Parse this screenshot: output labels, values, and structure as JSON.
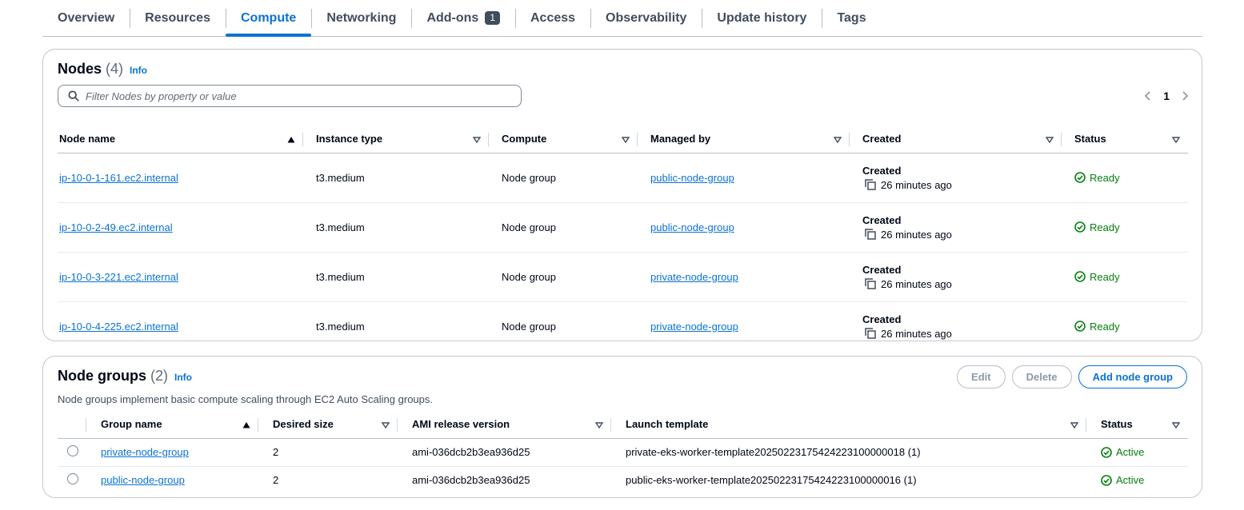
{
  "tabs": [
    {
      "label": "Overview"
    },
    {
      "label": "Resources"
    },
    {
      "label": "Compute",
      "active": true
    },
    {
      "label": "Networking"
    },
    {
      "label": "Add-ons",
      "badge": "1"
    },
    {
      "label": "Access"
    },
    {
      "label": "Observability"
    },
    {
      "label": "Update history"
    },
    {
      "label": "Tags"
    }
  ],
  "nodes": {
    "title": "Nodes",
    "count": "(4)",
    "info": "Info",
    "search_placeholder": "Filter Nodes by property or value",
    "page": "1",
    "columns": [
      "Node name",
      "Instance type",
      "Compute",
      "Managed by",
      "Created",
      "Status"
    ],
    "rows": [
      {
        "name": "ip-10-0-1-161.ec2.internal",
        "instance_type": "t3.medium",
        "compute": "Node group",
        "managed_by": "public-node-group",
        "created_label": "Created",
        "created": "26 minutes ago",
        "status": "Ready"
      },
      {
        "name": "ip-10-0-2-49.ec2.internal",
        "instance_type": "t3.medium",
        "compute": "Node group",
        "managed_by": "public-node-group",
        "created_label": "Created",
        "created": "26 minutes ago",
        "status": "Ready"
      },
      {
        "name": "ip-10-0-3-221.ec2.internal",
        "instance_type": "t3.medium",
        "compute": "Node group",
        "managed_by": "private-node-group",
        "created_label": "Created",
        "created": "26 minutes ago",
        "status": "Ready"
      },
      {
        "name": "ip-10-0-4-225.ec2.internal",
        "instance_type": "t3.medium",
        "compute": "Node group",
        "managed_by": "private-node-group",
        "created_label": "Created",
        "created": "26 minutes ago",
        "status": "Ready"
      }
    ]
  },
  "node_groups": {
    "title": "Node groups",
    "count": "(2)",
    "info": "Info",
    "description": "Node groups implement basic compute scaling through EC2 Auto Scaling groups.",
    "buttons": {
      "edit": "Edit",
      "delete": "Delete",
      "add": "Add node group"
    },
    "columns": [
      "Group name",
      "Desired size",
      "AMI release version",
      "Launch template",
      "Status"
    ],
    "rows": [
      {
        "name": "private-node-group",
        "desired_size": "2",
        "ami": "ami-036dcb2b3ea936d25",
        "launch_template": "private-eks-worker-template20250223175424223100000018 (1)",
        "status": "Active"
      },
      {
        "name": "public-node-group",
        "desired_size": "2",
        "ami": "ami-036dcb2b3ea936d25",
        "launch_template": "public-eks-worker-template20250223175424223100000016 (1)",
        "status": "Active"
      }
    ]
  },
  "colors": {
    "link": "#0972d3",
    "success": "#037f0c",
    "text": "#000716"
  }
}
